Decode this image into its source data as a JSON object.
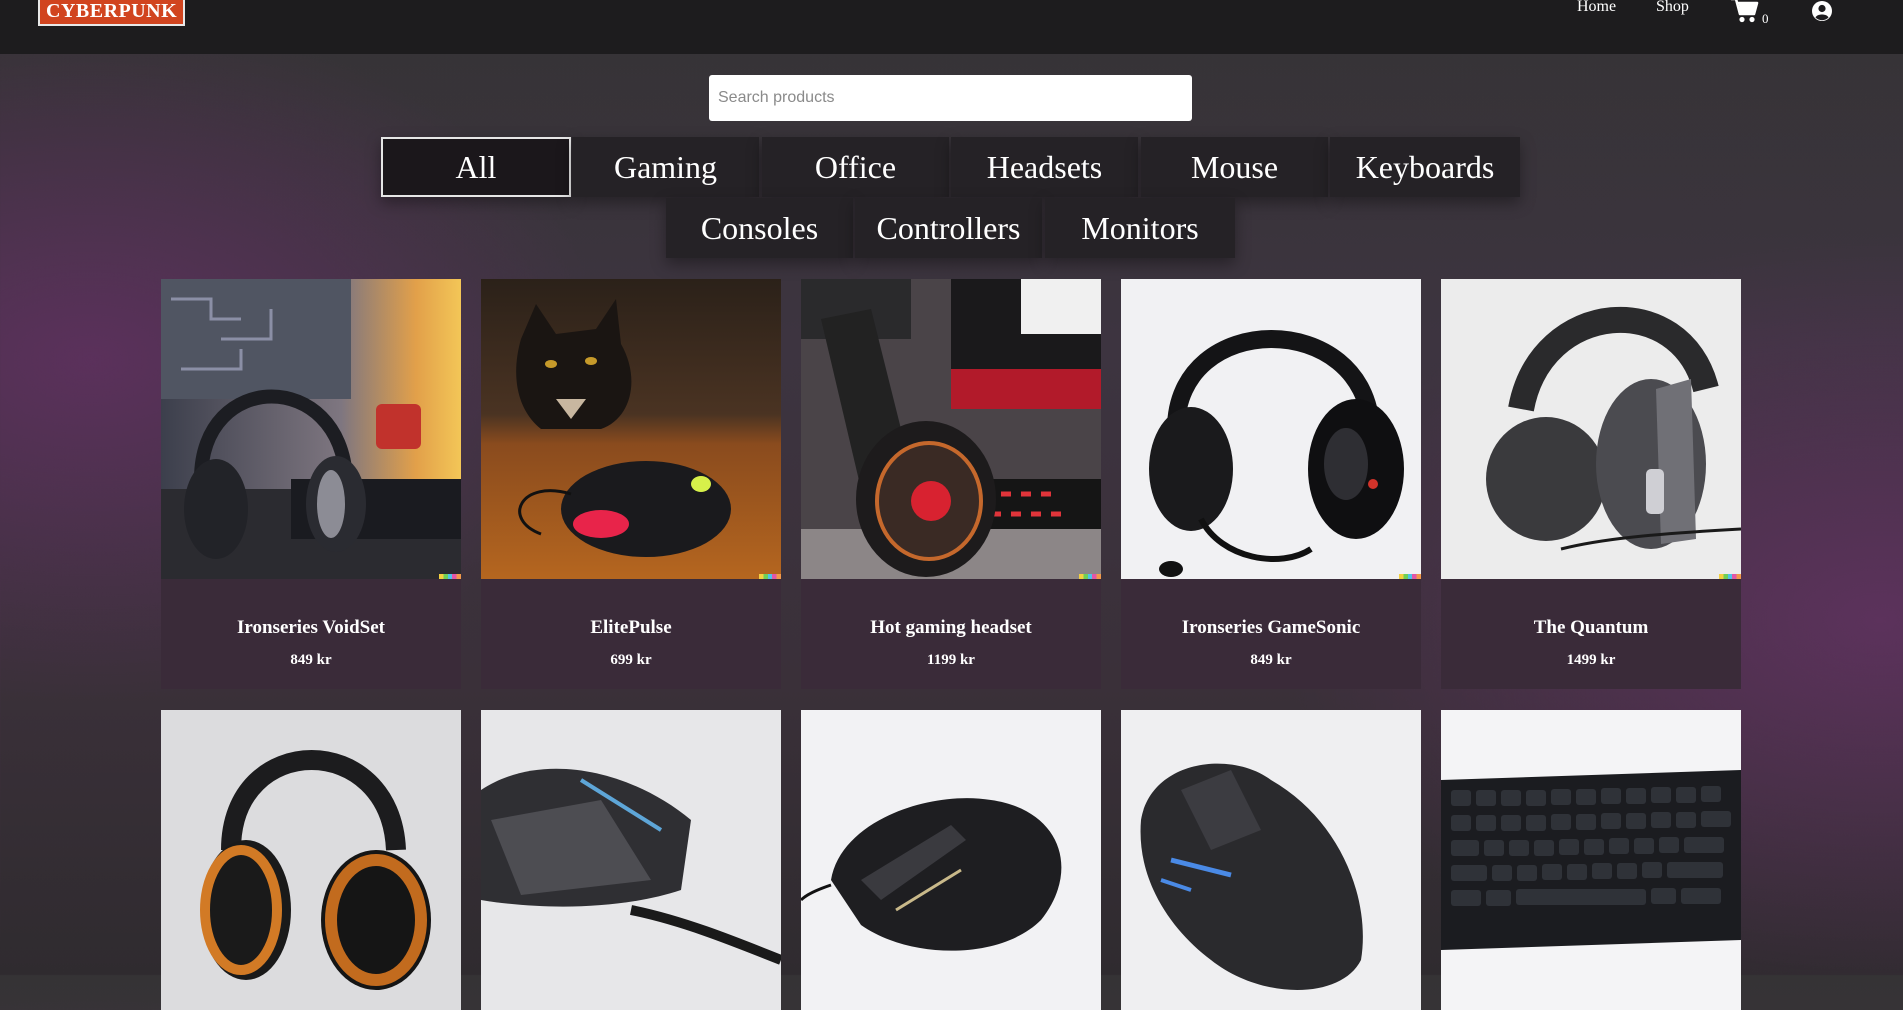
{
  "header": {
    "logo_text": "CYBERPUNK",
    "nav": [
      {
        "label": "Home"
      },
      {
        "label": "Shop"
      }
    ],
    "cart_count": "0",
    "icons": {
      "cart": "cart-icon",
      "user": "user-circle-icon"
    }
  },
  "search": {
    "placeholder": "Search products",
    "value": ""
  },
  "categories": [
    {
      "label": "All",
      "active": true
    },
    {
      "label": "Gaming"
    },
    {
      "label": "Office"
    },
    {
      "label": "Headsets"
    },
    {
      "label": "Mouse"
    },
    {
      "label": "Keyboards"
    },
    {
      "label": "Consoles"
    },
    {
      "label": "Controllers"
    },
    {
      "label": "Monitors"
    }
  ],
  "products": [
    {
      "name": "Ironseries VoidSet",
      "price": "849 kr",
      "image": "headset-on-desk-image"
    },
    {
      "name": "ElitePulse",
      "price": "699 kr",
      "image": "cat-with-mouse-image"
    },
    {
      "name": "Hot gaming headset",
      "price": "1199 kr",
      "image": "red-headset-image"
    },
    {
      "name": "Ironseries GameSonic",
      "price": "849 kr",
      "image": "black-headset-white-image"
    },
    {
      "name": "The Quantum",
      "price": "1499 kr",
      "image": "grey-headset-image"
    },
    {
      "name": "",
      "price": "",
      "image": "orange-headphones-image"
    },
    {
      "name": "",
      "price": "",
      "image": "grey-mouse-image"
    },
    {
      "name": "",
      "price": "",
      "image": "black-mouse-image"
    },
    {
      "name": "",
      "price": "",
      "image": "blue-lit-mouse-image"
    },
    {
      "name": "",
      "price": "",
      "image": "keyboard-image"
    }
  ],
  "colors": {
    "header_bg": "#1d1c1e",
    "logo_bg": "#d1441f",
    "category_bg": "#252226",
    "card_info_bg": "#3a2b39"
  }
}
